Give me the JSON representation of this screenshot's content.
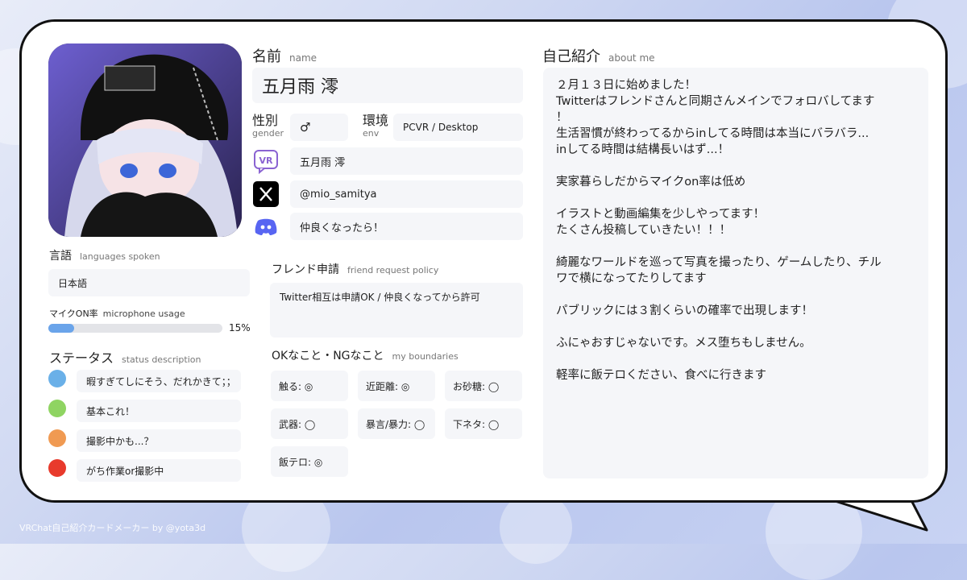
{
  "theme": {
    "card_bg": "#ffffff",
    "field_bg": "#f5f6f9",
    "accent": "#6aa4ea"
  },
  "profile": {
    "name_label": "名前",
    "name_label_en": "name",
    "name": "五月雨 澪",
    "gender_label": "性別",
    "gender_label_en": "gender",
    "gender": "♂",
    "env_label": "環境",
    "env_label_en": "env",
    "env": "PCVR / Desktop"
  },
  "accounts": [
    {
      "icon": "vrchat-icon",
      "value": "五月雨 澪"
    },
    {
      "icon": "x-icon",
      "value": "@mio_samitya"
    },
    {
      "icon": "discord-icon",
      "value": "仲良くなったら！"
    }
  ],
  "languages": {
    "label": "言語",
    "label_en": "languages spoken",
    "value": "日本語"
  },
  "microphone": {
    "label": "マイクON率",
    "label_en": "microphone usage",
    "percent": 15,
    "percent_text": "15%"
  },
  "status": {
    "label": "ステータス",
    "label_en": "status description",
    "items": [
      {
        "color": "#6ab0e8",
        "text": "暇すぎてしにそう、だれかきて；；"
      },
      {
        "color": "#8fd462",
        "text": "基本これ！"
      },
      {
        "color": "#f09a52",
        "text": "撮影中かも...？"
      },
      {
        "color": "#e83a2c",
        "text": "がち作業or撮影中"
      }
    ]
  },
  "friend_request": {
    "label": "フレンド申請",
    "label_en": "friend request policy",
    "value": "Twitter相互は申請OK / 仲良くなってから許可"
  },
  "boundaries": {
    "label": "OKなこと・NGなこと",
    "label_en": "my boundaries",
    "items": [
      "触る: ◎",
      "近距離: ◎",
      "お砂糖: ◯",
      "武器: ◯",
      "暴言/暴力: ◯",
      "下ネタ: ◯",
      "飯テロ: ◎"
    ]
  },
  "about": {
    "label": "自己紹介",
    "label_en": "about me",
    "lines": [
      "２月１３日に始めました！",
      "Twitterはフレンドさんと同期さんメインでフォロバしてます",
      "！",
      "生活習慣が終わってるからinしてる時間は本当にバラバラ...",
      "inしてる時間は結構長いはず...！",
      "",
      "実家暮らしだからマイクon率は低め",
      "",
      "イラストと動画編集を少しやってます！",
      "たくさん投稿していきたい！！！",
      "",
      "綺麗なワールドを巡って写真を撮ったり、ゲームしたり、チル",
      "ワで横になってたりしてます",
      "",
      "パブリックには３割くらいの確率で出現します！",
      "",
      "ふにゃおすじゃないです。メス堕ちもしません。",
      "",
      "軽率に飯テロください、食べに行きます"
    ]
  },
  "footer": "VRChat自己紹介カードメーカー by @yota3d"
}
